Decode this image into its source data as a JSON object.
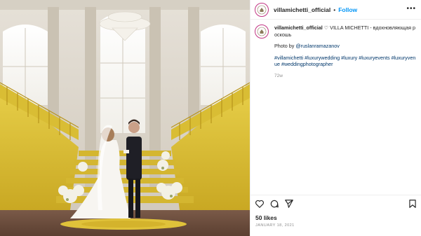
{
  "post": {
    "username": "villamichetti_official",
    "follow_label": "Follow",
    "separator": "•",
    "more_label": "•••",
    "caption_text": "♡ VILLA MICHETTI - вдохновляющая роскошь",
    "photo_by_prefix": "Photo by ",
    "photo_by_handle": "@ruslanramazanov",
    "hashtags": "#villamichetti #luxurywedding #luxury #luxuryevents #luxuryvenue #weddingphotographer",
    "time_ago": "72w",
    "likes": "50 likes",
    "date": "JANUARY 18, 2021"
  },
  "icons": {
    "avatar": "villa-logo",
    "like": "heart-icon",
    "comment": "comment-icon",
    "share": "paper-plane-icon",
    "save": "bookmark-icon"
  },
  "colors": {
    "accent": "#0095f6",
    "link": "#00376b",
    "muted": "#8e8e8e",
    "gold": "#e0c23a"
  }
}
